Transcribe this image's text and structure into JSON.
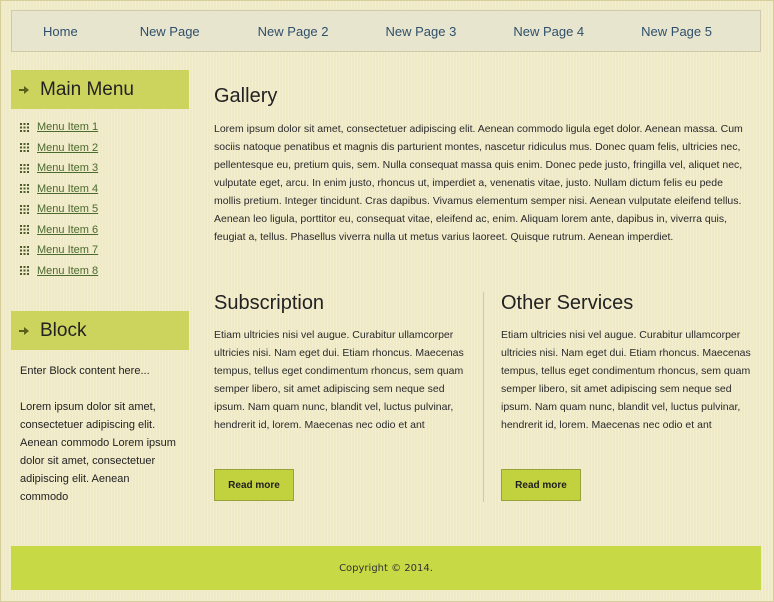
{
  "nav": {
    "items": [
      "Home",
      "New Page",
      "New Page 2",
      "New Page 3",
      "New Page 4",
      "New Page 5"
    ]
  },
  "sidebar": {
    "main_menu_title": "Main Menu",
    "menu_items": [
      "Menu Item 1",
      "Menu Item 2",
      "Menu Item 3",
      "Menu Item 4",
      "Menu Item 5",
      "Menu Item 6",
      "Menu Item 7",
      "Menu Item 8"
    ],
    "block_title": "Block",
    "block_intro": "Enter Block content here...",
    "block_text": "Lorem ipsum dolor sit amet, consectetuer adipiscing elit. Aenean commodo Lorem ipsum dolor sit amet, consectetuer adipiscing elit. Aenean commodo"
  },
  "main": {
    "title": "Gallery",
    "text": "Lorem ipsum dolor sit amet, consectetuer adipiscing elit. Aenean commodo ligula eget dolor. Aenean massa. Cum sociis natoque penatibus et magnis dis parturient montes, nascetur ridiculus mus. Donec quam felis, ultricies nec, pellentesque eu, pretium quis, sem. Nulla consequat massa quis enim. Donec pede justo, fringilla vel, aliquet nec, vulputate eget, arcu. In enim justo, rhoncus ut, imperdiet a, venenatis vitae, justo. Nullam dictum felis eu pede mollis pretium. Integer tincidunt. Cras dapibus. Vivamus elementum semper nisi. Aenean vulputate eleifend tellus. Aenean leo ligula, porttitor eu, consequat vitae, eleifend ac, enim. Aliquam lorem ante, dapibus in, viverra quis, feugiat a, tellus. Phasellus viverra nulla ut metus varius laoreet. Quisque rutrum. Aenean imperdiet."
  },
  "columns": [
    {
      "title": "Subscription",
      "text": "Etiam ultricies nisi vel augue. Curabitur ullamcorper ultricies nisi. Nam eget dui. Etiam rhoncus. Maecenas tempus, tellus eget condimentum rhoncus, sem quam semper libero, sit amet adipiscing sem neque sed ipsum. Nam quam nunc, blandit vel, luctus pulvinar, hendrerit id, lorem. Maecenas nec odio et ant",
      "button": "Read more"
    },
    {
      "title": "Other Services",
      "text": "Etiam ultricies nisi vel augue. Curabitur ullamcorper ultricies nisi. Nam eget dui. Etiam rhoncus. Maecenas tempus, tellus eget condimentum rhoncus, sem quam semper libero, sit amet adipiscing sem neque sed ipsum. Nam quam nunc, blandit vel, luctus pulvinar, hendrerit id, lorem. Maecenas nec odio et ant",
      "button": "Read more"
    }
  ],
  "footer": {
    "text": "Copyright © 2014."
  },
  "colors": {
    "background": "#efe9c6",
    "accent_green": "#cdd45e",
    "footer_green": "#c7d945",
    "button_green": "#c2d23e",
    "link_blue": "#2e4f6b"
  },
  "icons": {
    "header": "arrow-right-icon",
    "menu_item": "grid-icon"
  }
}
